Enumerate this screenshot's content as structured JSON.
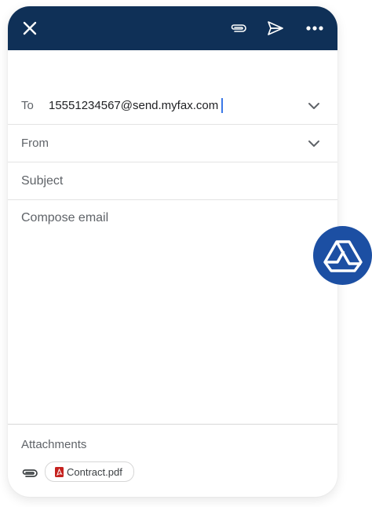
{
  "compose": {
    "to_label": "To",
    "to_value": "15551234567@send.myfax.com",
    "from_label": "From",
    "subject_placeholder": "Subject",
    "body_placeholder": "Compose email"
  },
  "attachments": {
    "title": "Attachments",
    "files": [
      {
        "name": "Contract.pdf",
        "icon": "pdf-icon"
      }
    ]
  },
  "toolbar": {
    "close_icon": "close-icon",
    "attach_icon": "paperclip-icon",
    "send_icon": "send-icon",
    "more_icon": "more-options-icon"
  },
  "colors": {
    "header": "#0f3057",
    "caret": "#3b78e7",
    "drive_fab": "#1c4fa3",
    "pdf_red": "#c5221f"
  }
}
